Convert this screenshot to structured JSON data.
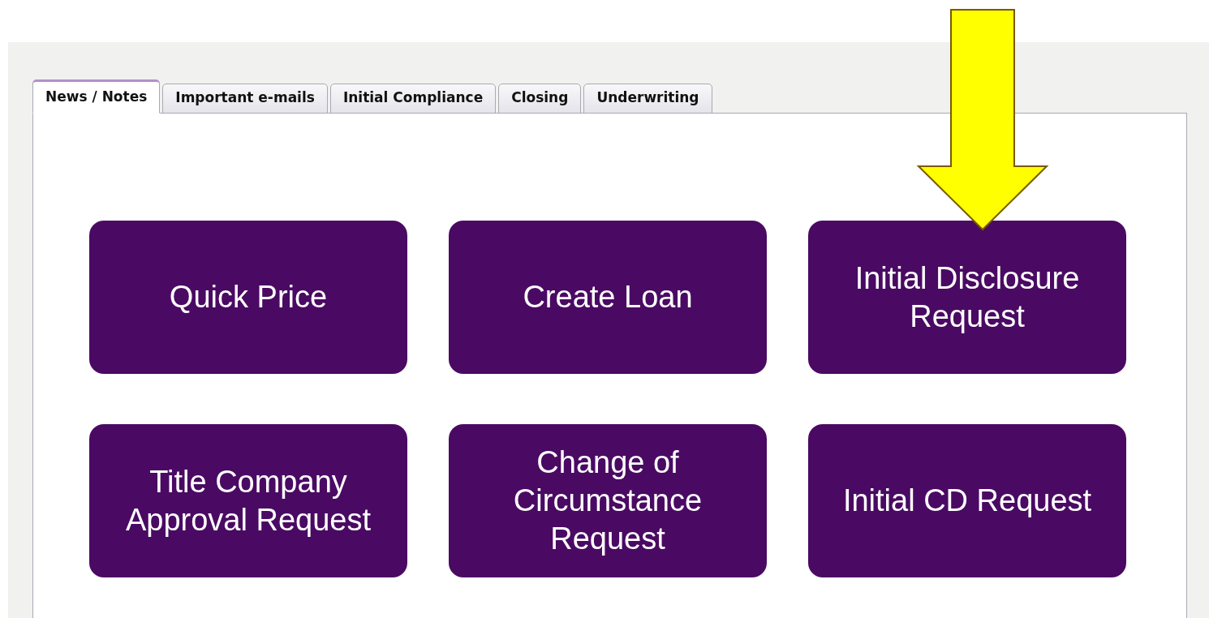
{
  "tabs": [
    {
      "label": "News / Notes",
      "selected": true
    },
    {
      "label": "Important e-mails",
      "selected": false
    },
    {
      "label": "Initial Compliance",
      "selected": false
    },
    {
      "label": "Closing",
      "selected": false
    },
    {
      "label": "Underwriting",
      "selected": false
    }
  ],
  "actions": [
    {
      "label": "Quick Price"
    },
    {
      "label": "Create Loan"
    },
    {
      "label": "Initial Disclosure Request"
    },
    {
      "label": "Title Company Approval Request"
    },
    {
      "label": "Change of Circumstance Request"
    },
    {
      "label": "Initial CD Request"
    }
  ],
  "annotation": {
    "kind": "arrow"
  }
}
